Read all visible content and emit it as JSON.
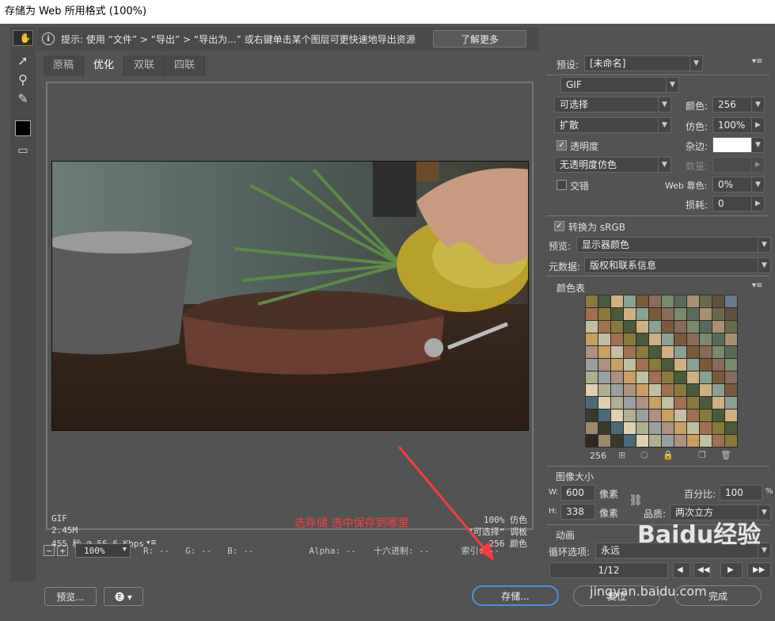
{
  "window": {
    "title": "存储为 Web 所用格式 (100%)"
  },
  "tools": [
    {
      "name": "hand-icon",
      "glyph": "✋"
    },
    {
      "name": "slice-select-icon",
      "glyph": "➚"
    },
    {
      "name": "zoom-icon",
      "glyph": "⚲"
    },
    {
      "name": "eyedropper-icon",
      "glyph": "✎"
    },
    {
      "name": "color-swatch-icon",
      "glyph": ""
    },
    {
      "name": "preview-toggle-icon",
      "glyph": "▭"
    }
  ],
  "hint": {
    "text": "提示: 使用 “文件” > “导出” > “导出为...” 或右键单击某个图层可更快速地导出资源",
    "learn_more": "了解更多"
  },
  "tabs": [
    "原稿",
    "优化",
    "双联",
    "四联"
  ],
  "active_tab": 1,
  "image_info": {
    "format": "GIF",
    "size": "2.45M",
    "time": "455 秒 @ 56.6 Kbps",
    "dither": "100% 仿色",
    "palette": "“可选择” 调板",
    "colors": "256 颜色"
  },
  "annotation": "选存储 选中保存到哪里",
  "statusbar": {
    "zoom": "100%",
    "r": "R: --",
    "g": "G: --",
    "b": "B: --",
    "alpha": "Alpha: --",
    "hex": "十六进制: --",
    "index": "索引: --"
  },
  "buttons": {
    "preview": "预览...",
    "save": "存储...",
    "reset": "复位",
    "done": "完成"
  },
  "panel": {
    "preset_label": "预设:",
    "preset_value": "[未命名]",
    "format": "GIF",
    "reduction": "可选择",
    "dither_algo": "扩散",
    "transparency_label": "透明度",
    "transparency_dither": "无透明度仿色",
    "interlaced_label": "交错",
    "colors_label": "颜色:",
    "colors_value": "256",
    "dither_label": "仿色:",
    "dither_value": "100%",
    "matte_label": "杂边:",
    "amount_label": "数量:",
    "websnap_label": "Web 靠色:",
    "websnap_value": "0%",
    "lossy_label": "损耗:",
    "lossy_value": "0",
    "srgb_label": "转换为 sRGB",
    "preview_label": "预览:",
    "preview_value": "显示器颜色",
    "metadata_label": "元数据:",
    "metadata_value": "版权和联系信息",
    "color_table_title": "颜色表",
    "color_count": "256",
    "image_size_title": "图像大小",
    "w_label": "W:",
    "w_value": "600",
    "h_label": "H:",
    "h_value": "338",
    "pixel_unit": "像素",
    "percent_label": "百分比:",
    "percent_value": "100",
    "percent_unit": "%",
    "quality_label": "品质:",
    "quality_value": "两次立方",
    "animation_title": "动画",
    "loop_label": "循环选项:",
    "loop_value": "永远",
    "frame_counter": "1/12"
  },
  "colors": {
    "accent_blue": "#4a90e2",
    "annotation_red": "#ff3b3b"
  },
  "watermark": {
    "logo": "Baidu经验",
    "url": "jingyan.baidu.com"
  }
}
